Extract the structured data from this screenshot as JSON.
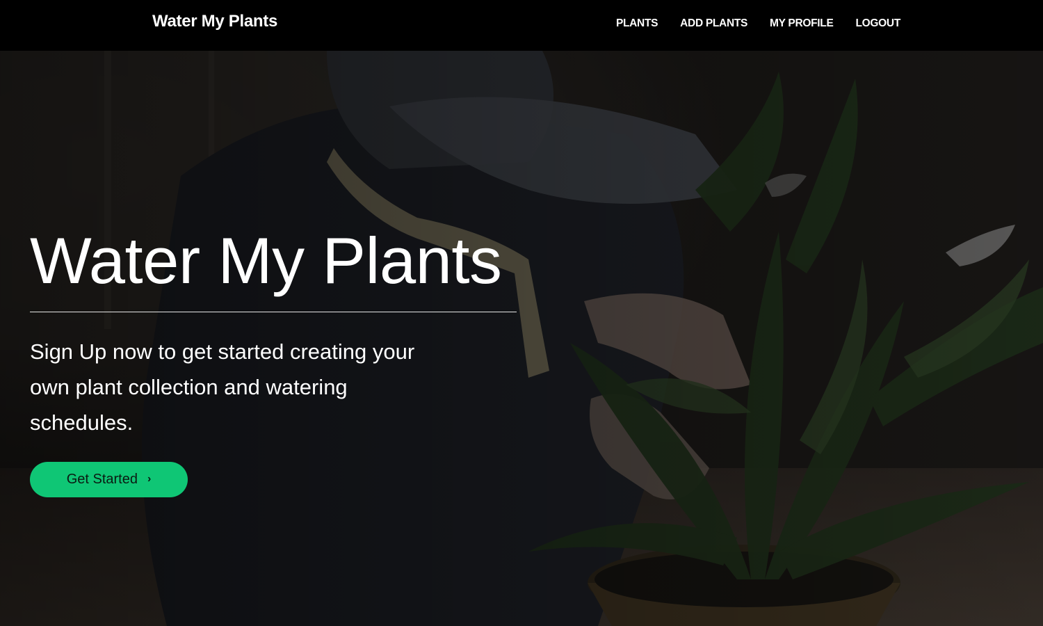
{
  "nav": {
    "brand": "Water My Plants",
    "links": [
      {
        "label": "PLANTS"
      },
      {
        "label": "ADD PLANTS"
      },
      {
        "label": "MY PROFILE"
      },
      {
        "label": "LOGOUT"
      }
    ]
  },
  "hero": {
    "title": "Water My Plants",
    "subtitle": "Sign Up now to get started creating your own plant collection and watering schedules.",
    "cta_label": "Get Started",
    "cta_icon": "chevron-right-icon",
    "background_image": "dimmed photo of a person tending a potted peace lily"
  },
  "colors": {
    "navbar_bg": "#000000",
    "accent": "#0fc675",
    "text": "#ffffff"
  }
}
